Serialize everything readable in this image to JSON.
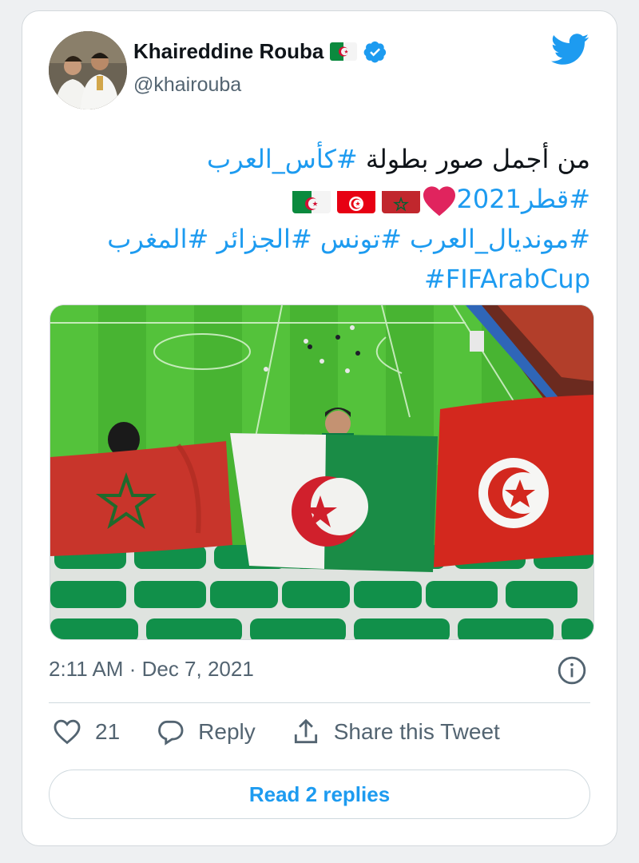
{
  "user": {
    "display_name": "Khaireddine Rouba",
    "handle": "@khairouba",
    "verified": true
  },
  "tweet": {
    "line1_text": "من أجمل صور بطولة ",
    "line1_tag": "#كأس_العرب",
    "line2_tag": "#قطر2021",
    "line2_emojis": [
      "heart",
      "morocco-flag",
      "tunisia-flag",
      "algeria-flag"
    ],
    "line3_tags": "#مونديال_العرب #تونس #الجزائر #المغرب",
    "line4_tag": "#FIFArabCup"
  },
  "meta": {
    "time": "2:11 AM",
    "separator": " · ",
    "date": "Dec 7, 2021"
  },
  "actions": {
    "like_count": "21",
    "reply_label": "Reply",
    "share_label": "Share this Tweet"
  },
  "read_replies_label": "Read 2 replies",
  "colors": {
    "accent": "#1d9bf0",
    "secondary_text": "#536471",
    "heart": "#e0245e"
  }
}
